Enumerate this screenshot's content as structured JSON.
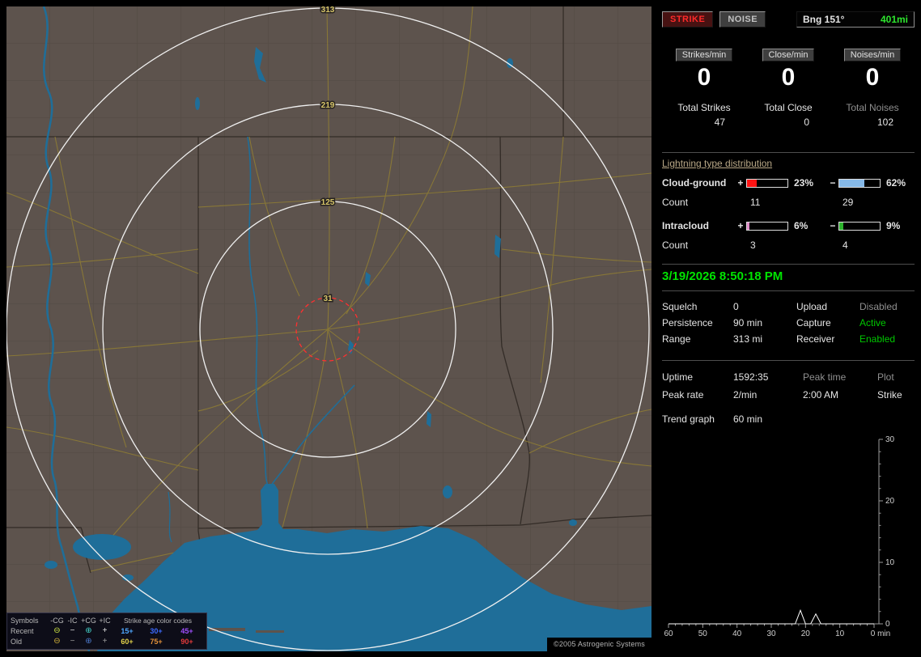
{
  "map": {
    "ring_labels": [
      "313",
      "219",
      "125",
      "31"
    ],
    "copyright": "©2005 Astrogenic Systems",
    "legend": {
      "symbols_header": "Symbols",
      "col_headers": [
        "-CG",
        "-IC",
        "+CG",
        "+IC"
      ],
      "age_header": "Strike age color codes",
      "rows": [
        {
          "label": "Recent",
          "symbols": [
            {
              "glyph": "⊖",
              "color": "#cbe244"
            },
            {
              "glyph": "−",
              "color": "#e0e0e0"
            },
            {
              "glyph": "⊕",
              "color": "#44d2c8"
            },
            {
              "glyph": "+",
              "color": "#e0e0e0"
            }
          ],
          "ages": [
            {
              "text": "15+",
              "color": "#4fa8ff"
            },
            {
              "text": "30+",
              "color": "#3d6bff"
            },
            {
              "text": "45+",
              "color": "#a04fff"
            }
          ]
        },
        {
          "label": "Old",
          "symbols": [
            {
              "glyph": "⊖",
              "color": "#d2b23a"
            },
            {
              "glyph": "−",
              "color": "#9a9a9a"
            },
            {
              "glyph": "⊕",
              "color": "#4a78c8"
            },
            {
              "glyph": "+",
              "color": "#9a9a9a"
            }
          ],
          "ages": [
            {
              "text": "60+",
              "color": "#e2d24a"
            },
            {
              "text": "75+",
              "color": "#e2913a"
            },
            {
              "text": "90+",
              "color": "#e23a3a"
            }
          ]
        }
      ]
    }
  },
  "sidebar": {
    "strike_label": "STRIKE",
    "noise_label": "NOISE",
    "bearing": "Bng 151°",
    "distance": "401mi",
    "rate_panels": [
      {
        "label": "Strikes/min",
        "value": "0",
        "total_label": "Total Strikes",
        "total": "47"
      },
      {
        "label": "Close/min",
        "value": "0",
        "total_label": "Total Close",
        "total": "0"
      },
      {
        "label": "Noises/min",
        "value": "0",
        "total_label": "Total Noises",
        "total": "102"
      }
    ],
    "distribution": {
      "title": "Lightning type distribution",
      "rows": [
        {
          "label": "Cloud-ground",
          "plus_sign": "+",
          "minus_sign": "−",
          "plus_pct": "23%",
          "minus_pct": "62%",
          "plus_fill": 23,
          "minus_fill": 62,
          "plus_color": "#ff1414",
          "minus_color": "#86b9e8",
          "count_label": "Count",
          "plus_count": "11",
          "minus_count": "29"
        },
        {
          "label": "Intracloud",
          "plus_sign": "+",
          "minus_sign": "−",
          "plus_pct": "6%",
          "minus_pct": "9%",
          "plus_fill": 6,
          "minus_fill": 9,
          "plus_color": "#e08cc8",
          "minus_color": "#2eb42e",
          "count_label": "Count",
          "plus_count": "3",
          "minus_count": "4"
        }
      ]
    },
    "timestamp": "3/19/2026 8:50:18 PM",
    "settings": [
      {
        "label": "Squelch",
        "value": "0",
        "label2": "Upload",
        "value2": "Disabled",
        "value2_color": "#8f8f8f"
      },
      {
        "label": "Persistence",
        "value": "90 min",
        "label2": "Capture",
        "value2": "Active",
        "value2_color": "#00c800"
      },
      {
        "label": "Range",
        "value": "313 mi",
        "label2": "Receiver",
        "value2": "Enabled",
        "value2_color": "#00c800"
      }
    ],
    "stats": {
      "uptime_label": "Uptime",
      "uptime": "1592:35",
      "peak_time_label": "Peak time",
      "plot_label": "Plot",
      "peak_rate_label": "Peak rate",
      "peak_rate": "2/min",
      "peak_time": "2:00 AM",
      "plot_value": "Strike",
      "trend_label": "Trend graph",
      "trend_window": "60 min"
    },
    "trend_chart": {
      "type": "line",
      "y_ticks": [
        "30",
        "20",
        "10",
        "0"
      ],
      "x_ticks": [
        "60",
        "50",
        "40",
        "30",
        "20",
        "10",
        "0 min"
      ],
      "y_max": 30,
      "window_min": 60,
      "points": [
        [
          60,
          0
        ],
        [
          23,
          0
        ],
        [
          21.5,
          2.2
        ],
        [
          20,
          0
        ],
        [
          18.5,
          0
        ],
        [
          17,
          1.6
        ],
        [
          15.5,
          0
        ],
        [
          0,
          0
        ]
      ]
    }
  }
}
